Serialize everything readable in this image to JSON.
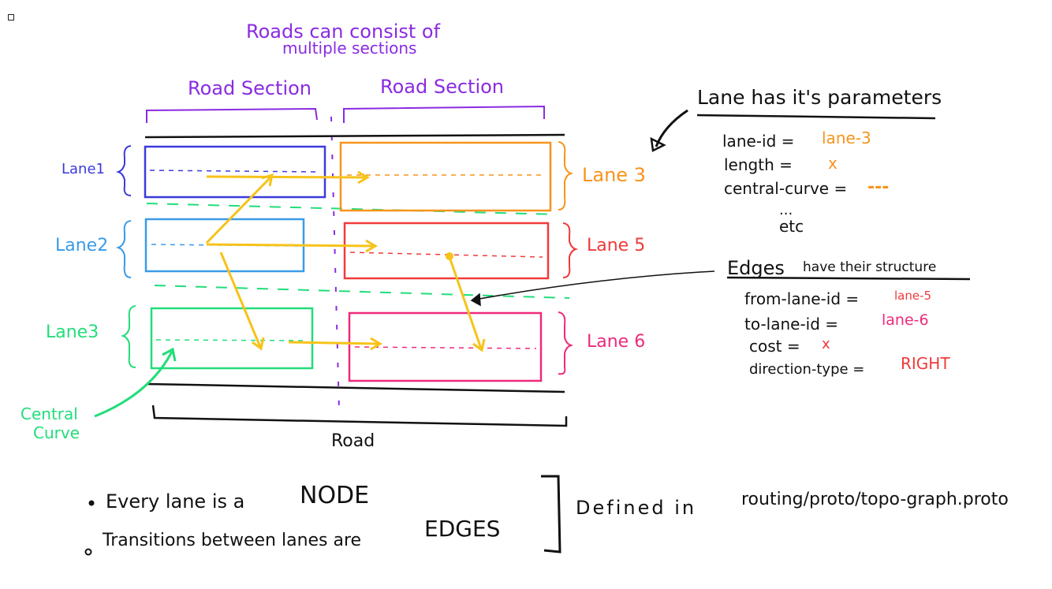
{
  "colors": {
    "purple": "#8a2be2",
    "blue": "#3b3bdb",
    "sky": "#3a9be8",
    "green": "#22dd7a",
    "orange": "#f7941d",
    "red": "#f03a3a",
    "pink": "#ee2a7b",
    "yellow": "#f7c31a",
    "ink": "#111111"
  },
  "header": {
    "line1": "Roads can consist of",
    "line2": "multiple sections"
  },
  "sections": {
    "left": "Road Section",
    "right": "Road Section"
  },
  "lanes": {
    "left1": "Lane1",
    "left2": "Lane2",
    "left3": "Lane3",
    "right1": "Lane 3",
    "right2": "Lane 5",
    "right3": "Lane 6"
  },
  "central_curve": {
    "line1": "Central",
    "line2": "Curve"
  },
  "road_label": "Road",
  "lane_params": {
    "title": "Lane has it's parameters",
    "lane_id_key": "lane-id =",
    "lane_id_val": "lane-3",
    "length_key": "length =",
    "length_val": "x",
    "curve_key": "central-curve =",
    "curve_val": "---",
    "dots": "...",
    "etc": "etc"
  },
  "edges": {
    "title_a": "Edges",
    "title_b": "have their structure",
    "from_key": "from-lane-id =",
    "from_val": "lane-5",
    "to_key": "to-lane-id =",
    "to_val": "lane-6",
    "cost_key": "cost =",
    "cost_val": "x",
    "dir_key": "direction-type =",
    "dir_val": "RIGHT"
  },
  "bullets": {
    "b1_text": "Every lane is a",
    "b1_em": "NODE",
    "b2_text": "Transitions between lanes are",
    "b2_em": "EDGES"
  },
  "defined": {
    "label": "Defined in",
    "path": "routing/proto/topo-graph.proto"
  }
}
